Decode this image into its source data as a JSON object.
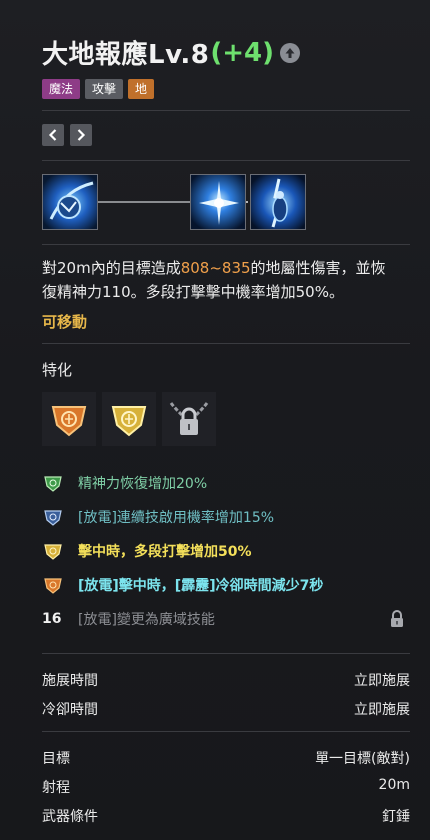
{
  "header": {
    "title": "大地報應Lv.8",
    "bonus": "(+4)",
    "tags": [
      "魔法",
      "攻擊",
      "地"
    ]
  },
  "description": {
    "part1": "對20m內的目標造成",
    "damage": "808~835",
    "part2": "的地屬性傷害，並恢復精神力110。多段打擊擊中機率增加50%。"
  },
  "movable": "可移動",
  "specialization": {
    "title": "特化",
    "items": [
      {
        "text": "精神力恢復增加20%"
      },
      {
        "text": "[放電]連續技啟用機率增加15%"
      },
      {
        "text": "擊中時，多段打擊增加50%"
      },
      {
        "text": "[放電]擊中時，[霹靂]冷卻時間減少7秒"
      },
      {
        "level": "16",
        "text": "[放電]變更為廣域技能"
      }
    ]
  },
  "stats_timing": [
    {
      "label": "施展時間",
      "value": "立即施展"
    },
    {
      "label": "冷卻時間",
      "value": "立即施展"
    }
  ],
  "stats_target": [
    {
      "label": "目標",
      "value": "單一目標(敵對)"
    },
    {
      "label": "射程",
      "value": "20m"
    },
    {
      "label": "武器條件",
      "value": "釘錘"
    }
  ],
  "colors": {
    "bonus_green": "#6ee06e",
    "damage_orange": "#f0a04b",
    "movable_gold": "#e7b74a",
    "tag_magic": "#8e3c87",
    "tag_attack": "#5a5c62",
    "tag_earth": "#c0702b"
  }
}
